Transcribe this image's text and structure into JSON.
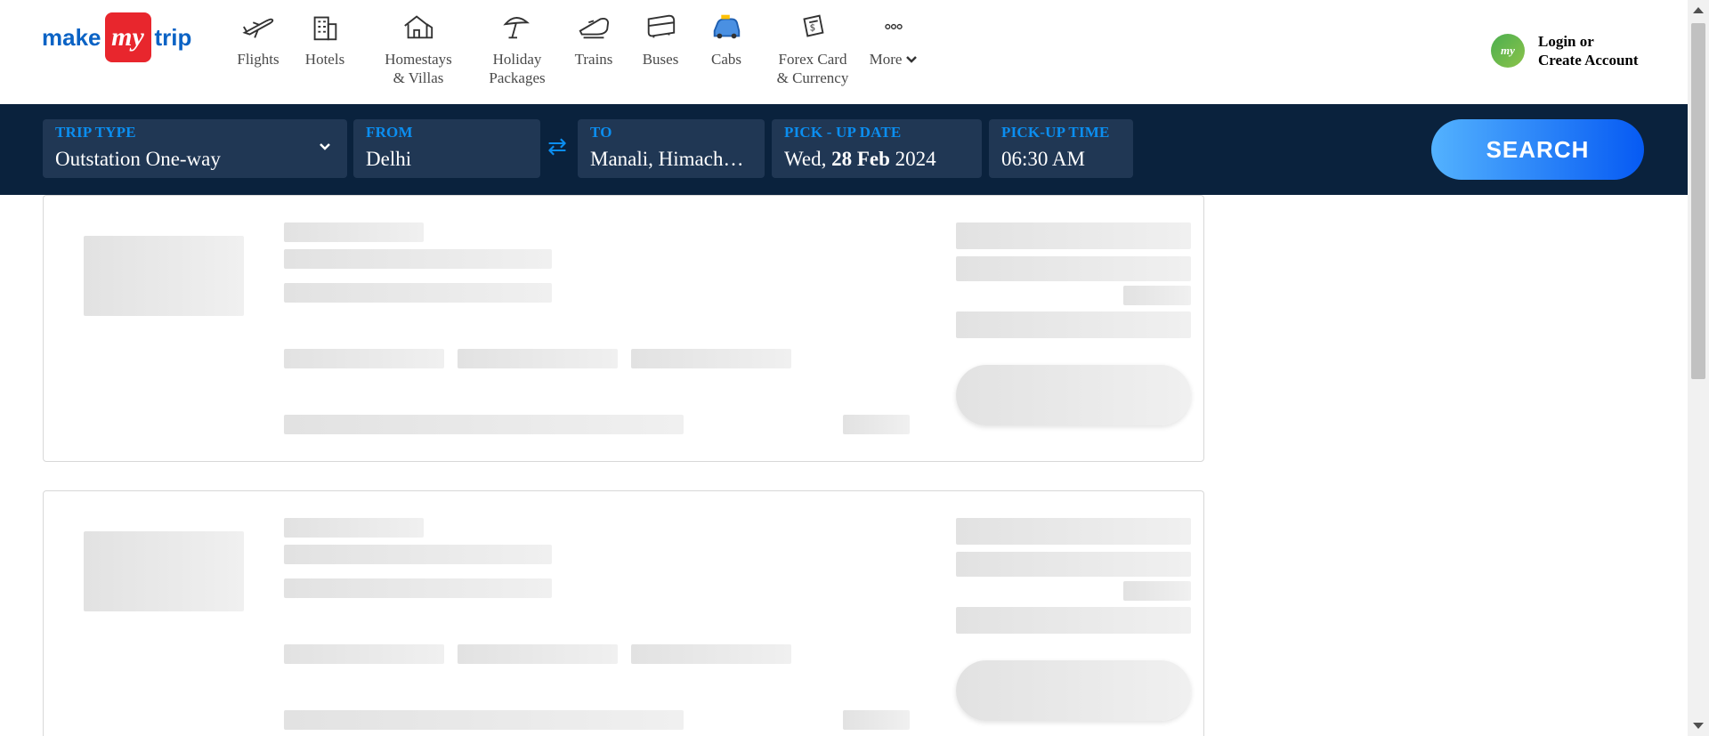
{
  "brand": {
    "logo_left": "make",
    "logo_badge": "my",
    "logo_right": "trip",
    "colors": {
      "primary_blue": "#0b63c5",
      "badge_red": "#e8262d",
      "accent_blue": "#0b8ef0",
      "widget_bg": "#0a223d"
    }
  },
  "nav": {
    "items": [
      {
        "label": "Flights",
        "icon": "airplane-icon"
      },
      {
        "label": "Hotels",
        "icon": "hotel-building-icon"
      },
      {
        "label": "Homestays\n& Villas",
        "icon": "house-icon"
      },
      {
        "label": "Holiday\nPackages",
        "icon": "umbrella-icon"
      },
      {
        "label": "Trains",
        "icon": "train-icon"
      },
      {
        "label": "Buses",
        "icon": "bus-icon"
      },
      {
        "label": "Cabs",
        "icon": "cab-icon"
      },
      {
        "label": "Forex Card\n& Currency",
        "icon": "forex-card-icon"
      },
      {
        "label": "More",
        "icon": "more-dots-icon"
      }
    ]
  },
  "account": {
    "avatar_text": "my",
    "line1": "Login or",
    "line2": "Create Account"
  },
  "search": {
    "trip_type": {
      "label": "TRIP TYPE",
      "value": "Outstation One-way"
    },
    "from": {
      "label": "FROM",
      "value": "Delhi"
    },
    "to": {
      "label": "TO",
      "value": "Manali, Himachal Pradesh"
    },
    "pickup_date": {
      "label": "PICK - UP DATE",
      "day": "Wed,",
      "date": "28 Feb",
      "year": "2024"
    },
    "pickup_time": {
      "label": "PICK-UP TIME",
      "value": "06:30 AM"
    },
    "swap_glyph": "⇄",
    "button_label": "SEARCH"
  }
}
